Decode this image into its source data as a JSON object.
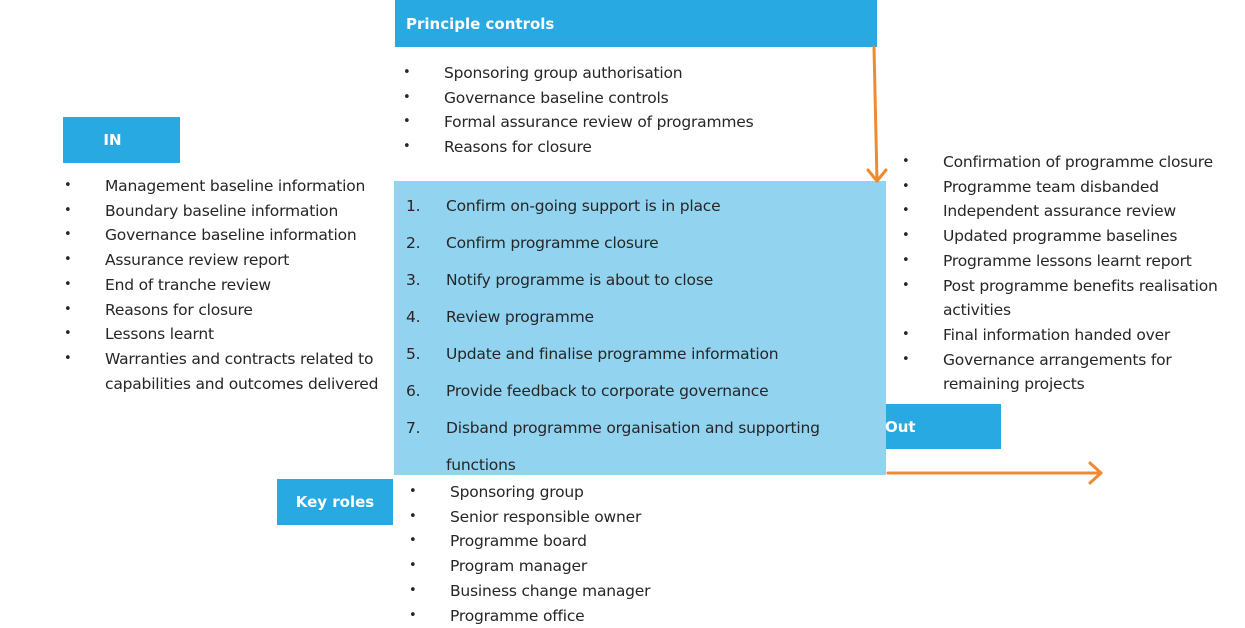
{
  "colors": {
    "label_blue": "#29a9e1",
    "process_blue": "#92d3f0",
    "arrow_orange": "#f08a30"
  },
  "principle_controls": {
    "title": "Principle controls",
    "items": [
      "Sponsoring group authorisation",
      "Governance baseline controls",
      "Formal assurance review of programmes",
      "Reasons for closure"
    ]
  },
  "inputs": {
    "title": "IN",
    "items": [
      "Management baseline information",
      "Boundary baseline information",
      "Governance baseline information",
      "Assurance review report",
      "End of tranche review",
      "Reasons for closure",
      "Lessons learnt",
      "Warranties and contracts related to capabilities and outcomes delivered"
    ]
  },
  "process": {
    "steps": [
      {
        "num": "1.",
        "text": "Confirm on-going support is in place"
      },
      {
        "num": "2.",
        "text": "Confirm programme closure"
      },
      {
        "num": "3.",
        "text": "Notify programme is about to close"
      },
      {
        "num": "4.",
        "text": "Review programme"
      },
      {
        "num": "5.",
        "text": "Update and finalise programme information"
      },
      {
        "num": "6.",
        "text": "Provide feedback to corporate governance"
      },
      {
        "num": "7.",
        "text": "Disband programme organisation and supporting functions"
      }
    ]
  },
  "outputs": {
    "title": "Out",
    "items": [
      "Confirmation of programme closure",
      "Programme team disbanded",
      "Independent assurance review",
      "Updated programme baselines",
      "Programme lessons learnt report",
      "Post programme benefits realisation activities",
      "Final information handed over",
      "Governance arrangements for remaining projects"
    ]
  },
  "key_roles": {
    "title": "Key roles",
    "items": [
      "Sponsoring group",
      "Senior responsible owner",
      "Programme board",
      "Program manager",
      "Business change manager",
      "Programme office"
    ]
  }
}
